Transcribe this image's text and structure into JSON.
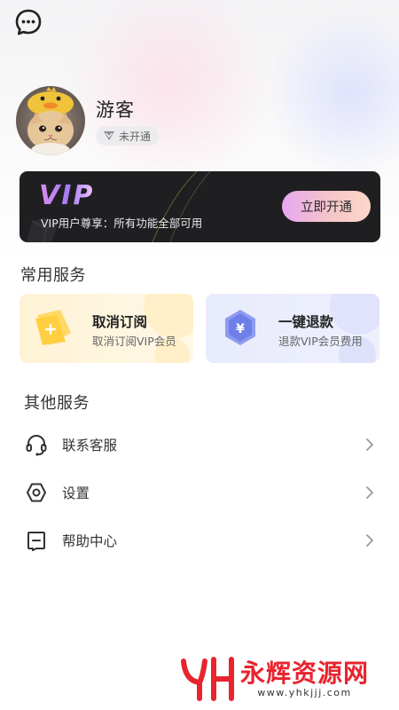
{
  "profile": {
    "username": "游客",
    "vip_status": "未开通"
  },
  "vip_card": {
    "logo_text": "VIP",
    "description": "VIP用户尊享：所有功能全部可用",
    "open_button": "立即开通"
  },
  "common_services": {
    "title": "常用服务",
    "items": [
      {
        "title": "取消订阅",
        "subtitle": "取消订阅VIP会员",
        "icon": "cancel-subscription-icon"
      },
      {
        "title": "一键退款",
        "subtitle": "退款VIP会员费用",
        "icon": "refund-yuan-icon"
      }
    ]
  },
  "other_services": {
    "title": "其他服务",
    "items": [
      {
        "label": "联系客服",
        "icon": "headset-icon"
      },
      {
        "label": "设置",
        "icon": "settings-hexagon-icon"
      },
      {
        "label": "帮助中心",
        "icon": "help-center-icon"
      }
    ]
  },
  "watermark": {
    "brand": "永辉资源网",
    "url": "www.yhkjjj.com"
  },
  "colors": {
    "vip_card_bg": "#1f1f22",
    "vip_button_start": "#e7a7ef",
    "vip_button_end": "#fbd8c8",
    "cancel_card_bg": "#fff3d6",
    "refund_card_bg": "#e8ebfc",
    "watermark_red": "#e8242f"
  }
}
